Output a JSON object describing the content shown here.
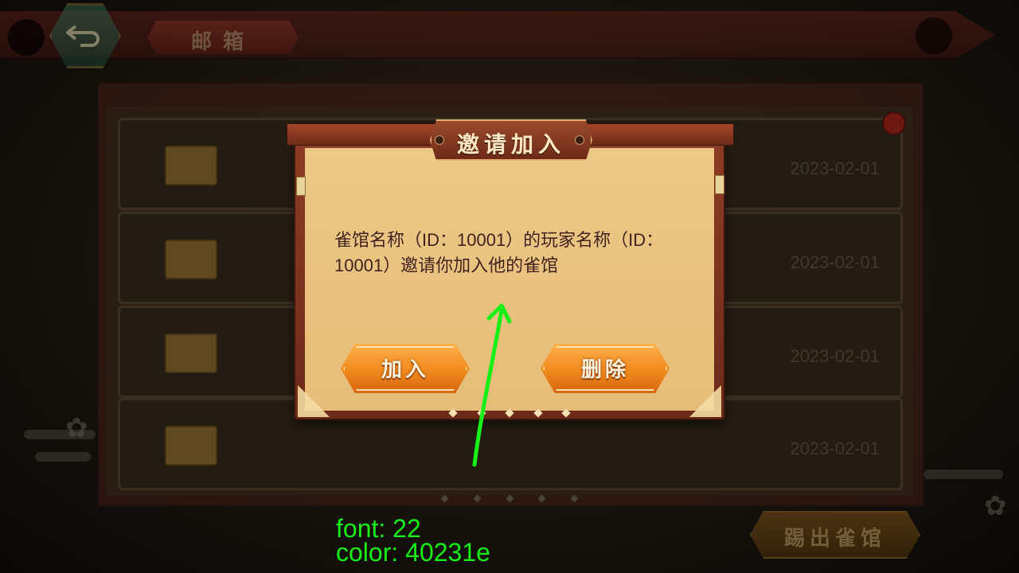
{
  "header": {
    "title": "邮箱"
  },
  "mail_list": {
    "items": [
      {
        "date": "2023-02-01"
      },
      {
        "date": "2023-02-01"
      },
      {
        "date": "2023-02-01"
      },
      {
        "date": "2023-02-01"
      }
    ]
  },
  "footer": {
    "kick_label": "踢出雀馆"
  },
  "dialog": {
    "title": "邀请加入",
    "message": "雀馆名称（ID：10001）的玩家名称（ID：10001）邀请你加入他的雀馆",
    "join_label": "加入",
    "delete_label": "删除"
  },
  "annotation": {
    "font": "font: 22",
    "color": "color: 40231e"
  },
  "colors": {
    "message_text": "#40231e",
    "annotation": "#16f016",
    "accent_orange": "#f08a1d"
  },
  "icons": [
    "back-arrow-icon",
    "envelope-icon",
    "notification-dot-icon",
    "flower-icon"
  ]
}
